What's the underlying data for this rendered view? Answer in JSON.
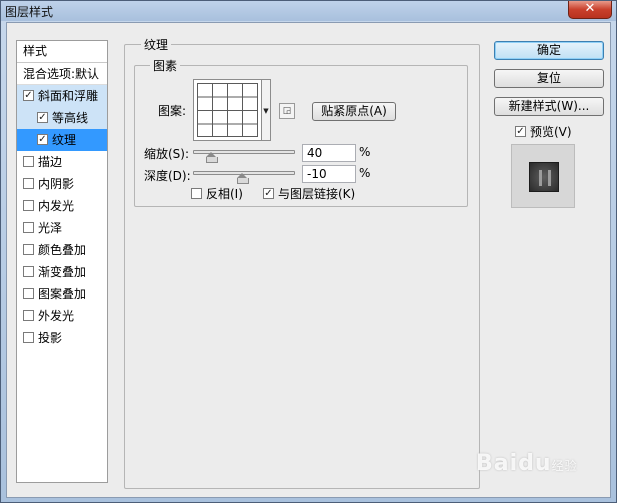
{
  "window": {
    "title": "图层样式",
    "close_label": "✕"
  },
  "left_panel": {
    "header": "样式",
    "blend_options": "混合选项:默认",
    "items": [
      {
        "label": "斜面和浮雕",
        "checked": true
      },
      {
        "label": "等高线",
        "checked": true
      },
      {
        "label": "纹理",
        "checked": true
      },
      {
        "label": "描边",
        "checked": false
      },
      {
        "label": "内阴影",
        "checked": false
      },
      {
        "label": "内发光",
        "checked": false
      },
      {
        "label": "光泽",
        "checked": false
      },
      {
        "label": "颜色叠加",
        "checked": false
      },
      {
        "label": "渐变叠加",
        "checked": false
      },
      {
        "label": "图案叠加",
        "checked": false
      },
      {
        "label": "外发光",
        "checked": false
      },
      {
        "label": "投影",
        "checked": false
      }
    ]
  },
  "texture": {
    "group_title": "纹理",
    "pattern_group_title": "图素",
    "pattern_label": "图案:",
    "snap_origin_button": "贴紧原点(A)",
    "scale_label": "缩放(S):",
    "scale_value": "40",
    "scale_percent": 40,
    "depth_label": "深度(D):",
    "depth_value": "-10",
    "depth_percent": -10,
    "percent_unit": "%",
    "invert_label": "反相(I)",
    "invert_checked": false,
    "link_label": "与图层链接(K)",
    "link_checked": true
  },
  "right_panel": {
    "ok_button": "确定",
    "reset_button": "复位",
    "new_style_button": "新建样式(W)...",
    "preview_label": "预览(V)",
    "preview_checked": true
  },
  "watermark": {
    "brand": "Baidu",
    "suffix": "经验"
  }
}
